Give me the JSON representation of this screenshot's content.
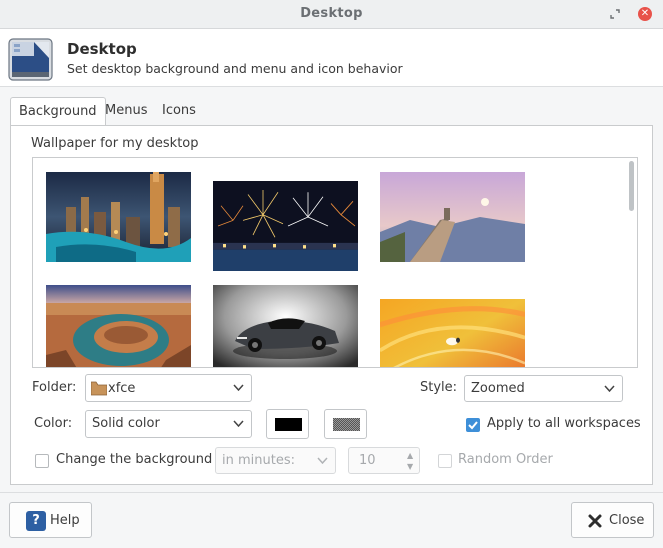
{
  "window": {
    "title": "Desktop"
  },
  "header": {
    "title": "Desktop",
    "subtitle": "Set desktop background and menu and icon behavior"
  },
  "tabs": [
    {
      "label": "Background",
      "active": true
    },
    {
      "label": "Menus",
      "active": false
    },
    {
      "label": "Icons",
      "active": false
    }
  ],
  "background": {
    "wallpaper_label": "Wallpaper for my desktop",
    "thumbnails": [
      {
        "name": "city-skyline-night"
      },
      {
        "name": "fireworks-harbor"
      },
      {
        "name": "great-wall-sunset"
      },
      {
        "name": "horseshoe-bend-canyon"
      },
      {
        "name": "sports-car"
      },
      {
        "name": "orange-abstract-xfce"
      }
    ],
    "folder_label": "Folder:",
    "folder_value": "xfce",
    "style_label": "Style:",
    "style_value": "Zoomed",
    "color_label": "Color:",
    "color_value": "Solid color",
    "primary_color": "#000000",
    "apply_all_label": "Apply to all workspaces",
    "apply_all_checked": true,
    "change_bg_label": "Change the background",
    "change_bg_checked": false,
    "interval_unit": "in minutes:",
    "interval_value": "10",
    "random_order_label": "Random Order",
    "random_order_checked": false
  },
  "footer": {
    "help_label": "Help",
    "close_label": "Close"
  },
  "colors": {
    "accent": "#3e8fd8",
    "close_button": "#e8524a"
  }
}
